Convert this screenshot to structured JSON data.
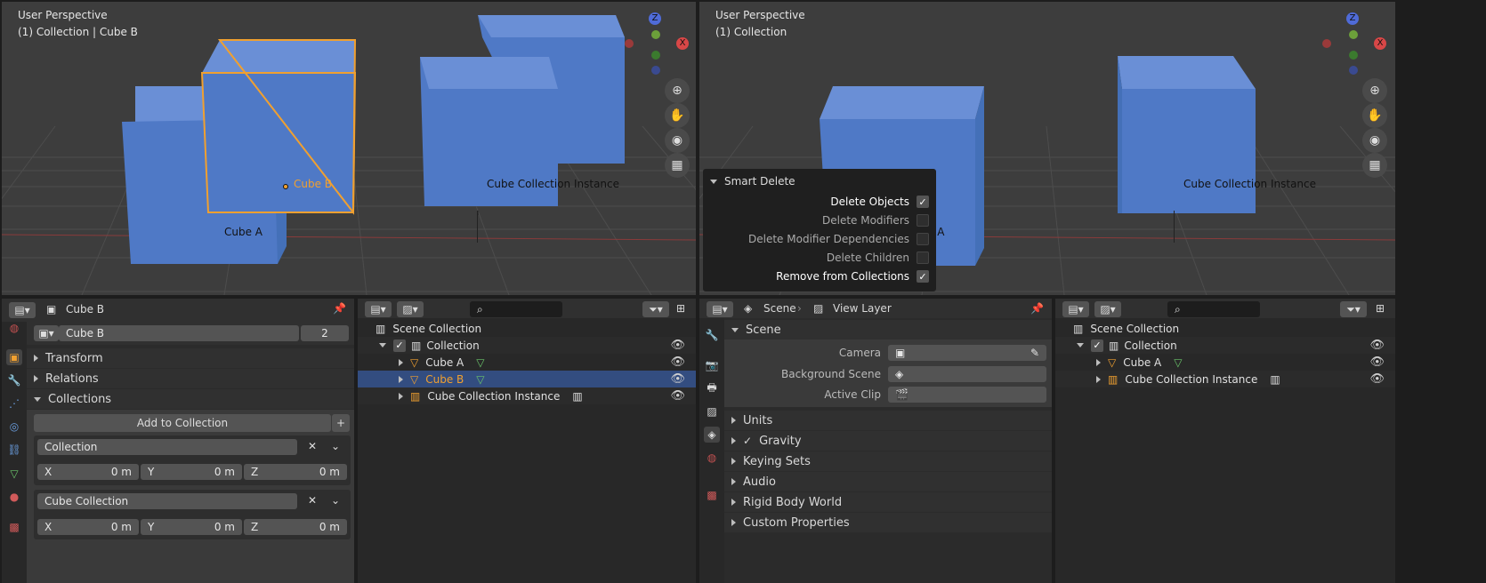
{
  "left_viewport": {
    "perspective": "User Perspective",
    "context": "(1) Collection | Cube B",
    "label_cube_a": "Cube A",
    "label_cube_b": "Cube B",
    "label_instance": "Cube Collection Instance"
  },
  "right_viewport": {
    "perspective": "User Perspective",
    "context": "(1) Collection",
    "label_cube_a": "e A",
    "label_instance": "Cube Collection Instance"
  },
  "gizmo": {
    "z": "Z",
    "x": "X"
  },
  "smart_delete": {
    "title": "Smart Delete",
    "options": [
      {
        "label": "Delete Objects",
        "checked": true
      },
      {
        "label": "Delete Modifiers",
        "checked": false
      },
      {
        "label": "Delete Modifier Dependencies",
        "checked": false
      },
      {
        "label": "Delete Children",
        "checked": false
      },
      {
        "label": "Remove from Collections",
        "checked": true
      }
    ]
  },
  "props_left": {
    "object_name": "Cube B",
    "mesh_name": "Cube B",
    "users": "2",
    "sections": [
      "Transform",
      "Relations",
      "Collections"
    ],
    "add_to_collection": "Add to Collection",
    "collections": [
      {
        "name": "Collection",
        "x_label": "X",
        "x": "0 m",
        "y_label": "Y",
        "y": "0 m",
        "z_label": "Z",
        "z": "0 m"
      },
      {
        "name": "Cube Collection",
        "x_label": "X",
        "x": "0 m",
        "y_label": "Y",
        "y": "0 m",
        "z_label": "Z",
        "z": "0 m"
      }
    ]
  },
  "outliner_left": {
    "scene_collection": "Scene Collection",
    "collection": "Collection",
    "items": [
      "Cube A",
      "Cube B",
      "Cube Collection Instance"
    ]
  },
  "props_right": {
    "scene_crumb": "Scene",
    "view_layer_crumb": "View Layer",
    "scene_section": "Scene",
    "camera_label": "Camera",
    "background_label": "Background Scene",
    "clip_label": "Active Clip",
    "sections": [
      "Units",
      "Gravity",
      "Keying Sets",
      "Audio",
      "Rigid Body World",
      "Custom Properties"
    ]
  },
  "outliner_right": {
    "scene_collection": "Scene Collection",
    "collection": "Collection",
    "items": [
      "Cube A",
      "Cube Collection Instance"
    ]
  },
  "colors": {
    "cube": "#4f79c6",
    "selected": "#f0a030",
    "highlight_row": "#334d80"
  }
}
